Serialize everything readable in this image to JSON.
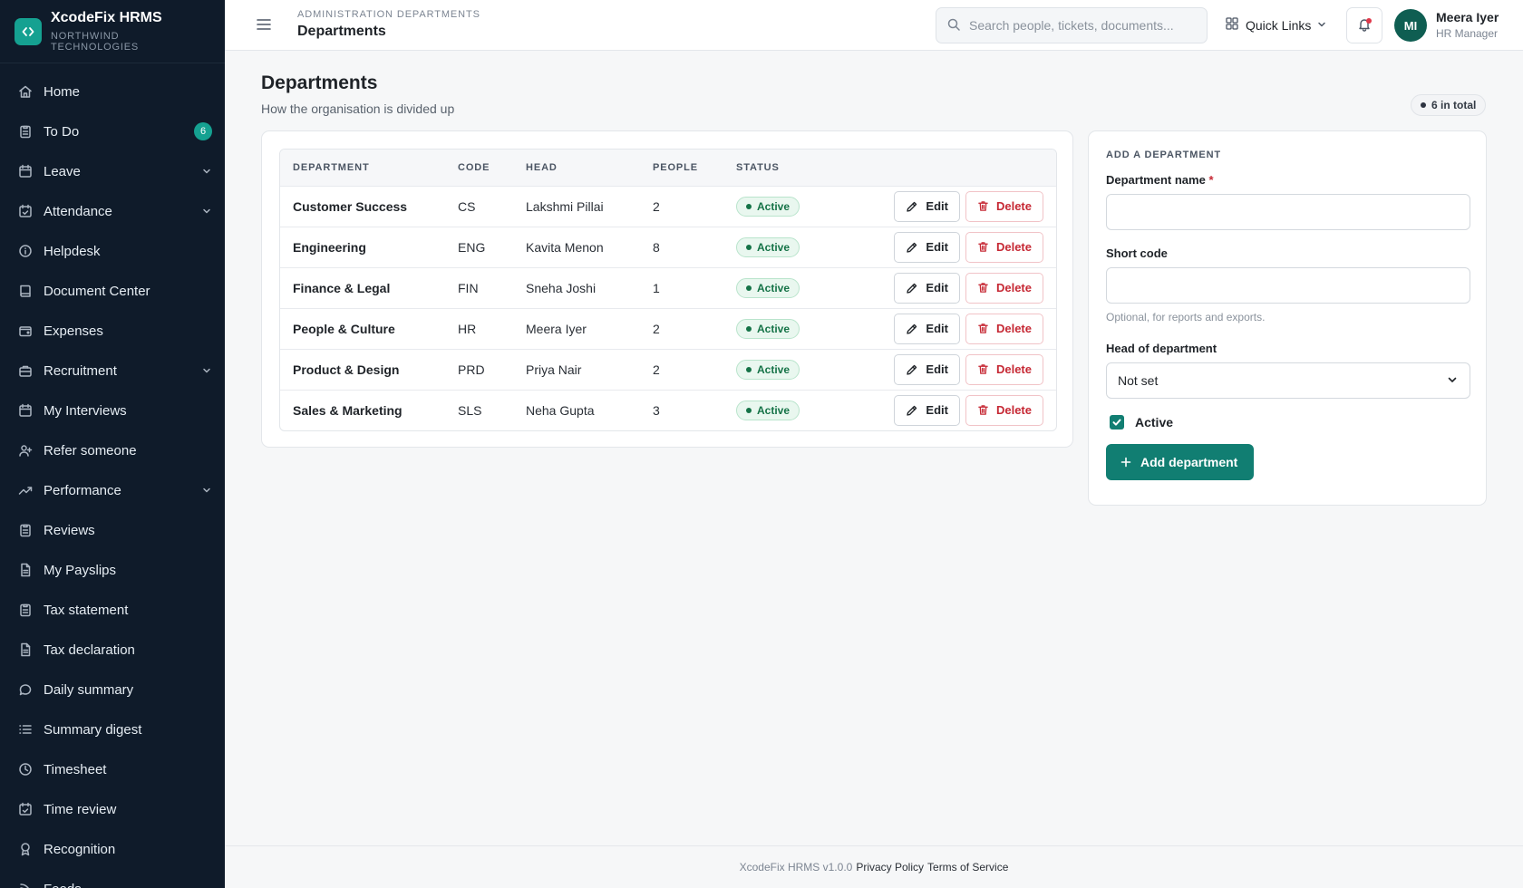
{
  "brand": {
    "name": "XcodeFix HRMS",
    "org": "NORTHWIND TECHNOLOGIES"
  },
  "sidebar": {
    "items": [
      {
        "label": "Home",
        "icon": "home-icon"
      },
      {
        "label": "To Do",
        "icon": "clipboard-icon",
        "badge": "6"
      },
      {
        "label": "Leave",
        "icon": "calendar-icon",
        "expandable": true
      },
      {
        "label": "Attendance",
        "icon": "calendar-check-icon",
        "expandable": true
      },
      {
        "label": "Helpdesk",
        "icon": "info-icon"
      },
      {
        "label": "Document Center",
        "icon": "book-icon"
      },
      {
        "label": "Expenses",
        "icon": "wallet-icon"
      },
      {
        "label": "Recruitment",
        "icon": "briefcase-icon",
        "expandable": true
      },
      {
        "label": "My Interviews",
        "icon": "calendar-icon"
      },
      {
        "label": "Refer someone",
        "icon": "user-plus-icon"
      },
      {
        "label": "Performance",
        "icon": "trending-up-icon",
        "expandable": true
      },
      {
        "label": "Reviews",
        "icon": "clipboard-icon"
      },
      {
        "label": "My Payslips",
        "icon": "file-icon"
      },
      {
        "label": "Tax statement",
        "icon": "clipboard-icon"
      },
      {
        "label": "Tax declaration",
        "icon": "file-icon"
      },
      {
        "label": "Daily summary",
        "icon": "chat-icon"
      },
      {
        "label": "Summary digest",
        "icon": "list-icon"
      },
      {
        "label": "Timesheet",
        "icon": "clock-icon"
      },
      {
        "label": "Time review",
        "icon": "calendar-check-icon"
      },
      {
        "label": "Recognition",
        "icon": "award-icon"
      },
      {
        "label": "Feeds",
        "icon": "feed-icon"
      }
    ]
  },
  "topbar": {
    "breadcrumb": "ADMINISTRATION DEPARTMENTS",
    "title": "Departments",
    "search_placeholder": "Search people, tickets, documents...",
    "quick_links": "Quick Links",
    "user": {
      "initials": "MI",
      "name": "Meera Iyer",
      "role": "HR Manager"
    }
  },
  "page": {
    "title": "Departments",
    "subtitle": "How the organisation is divided up",
    "total": "6 in total"
  },
  "table": {
    "columns": [
      "DEPARTMENT",
      "CODE",
      "HEAD",
      "PEOPLE",
      "STATUS"
    ],
    "edit_label": "Edit",
    "delete_label": "Delete",
    "rows": [
      {
        "department": "Customer Success",
        "code": "CS",
        "head": "Lakshmi Pillai",
        "people": "2",
        "status": "Active"
      },
      {
        "department": "Engineering",
        "code": "ENG",
        "head": "Kavita Menon",
        "people": "8",
        "status": "Active"
      },
      {
        "department": "Finance & Legal",
        "code": "FIN",
        "head": "Sneha Joshi",
        "people": "1",
        "status": "Active"
      },
      {
        "department": "People & Culture",
        "code": "HR",
        "head": "Meera Iyer",
        "people": "2",
        "status": "Active"
      },
      {
        "department": "Product & Design",
        "code": "PRD",
        "head": "Priya Nair",
        "people": "2",
        "status": "Active"
      },
      {
        "department": "Sales & Marketing",
        "code": "SLS",
        "head": "Neha Gupta",
        "people": "3",
        "status": "Active"
      }
    ]
  },
  "form": {
    "heading": "ADD A DEPARTMENT",
    "name_label": "Department name",
    "required_mark": "*",
    "name_value": "",
    "code_label": "Short code",
    "code_value": "",
    "code_hint": "Optional, for reports and exports.",
    "head_label": "Head of department",
    "head_value": "Not set",
    "active_label": "Active",
    "active_checked": true,
    "submit_label": "Add department"
  },
  "footer": {
    "version": "XcodeFix HRMS v1.0.0",
    "privacy": "Privacy Policy",
    "terms": "Terms of Service"
  },
  "colors": {
    "sidebar_bg": "#0f1b2a",
    "accent": "#117e72",
    "danger": "#c62834",
    "success": "#157347"
  }
}
